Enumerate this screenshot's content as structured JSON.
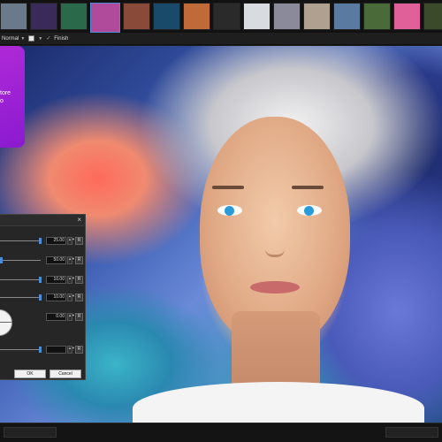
{
  "thumbnails": [
    {
      "name": "thumb-1",
      "color": "#6a7a8a"
    },
    {
      "name": "thumb-2",
      "color": "#3a2a5a"
    },
    {
      "name": "thumb-3",
      "color": "#2a6a4a"
    },
    {
      "name": "thumb-4",
      "color": "#b04a9a",
      "active": true
    },
    {
      "name": "thumb-5",
      "color": "#8a4a3a"
    },
    {
      "name": "thumb-6",
      "color": "#1a4a6a"
    },
    {
      "name": "thumb-7",
      "color": "#c06a3a"
    },
    {
      "name": "thumb-8",
      "color": "#2a2a2a"
    },
    {
      "name": "thumb-9",
      "color": "#d8dce0"
    },
    {
      "name": "thumb-10",
      "color": "#8a8a9a"
    },
    {
      "name": "thumb-11",
      "color": "#b0a090"
    },
    {
      "name": "thumb-12",
      "color": "#5a7aa0"
    },
    {
      "name": "thumb-13",
      "color": "#4a6a3a"
    },
    {
      "name": "thumb-14",
      "color": "#e0609a"
    },
    {
      "name": "thumb-15",
      "color": "#3a4a2a"
    }
  ],
  "options_bar": {
    "blend_mode": "Normal",
    "finish_label": "Finish"
  },
  "promo": {
    "line1": "tore",
    "line2": "o"
  },
  "dialog": {
    "close_icon": "×",
    "rows": [
      {
        "value": "25.00",
        "level": 1.0
      },
      {
        "value": "50.00",
        "level": 0.0
      },
      {
        "value": "10.00",
        "level": 1.0
      },
      {
        "value": "10.00",
        "level": 1.0
      },
      {
        "value": "0.00",
        "level": null
      },
      {
        "value": "",
        "level": 1.0
      }
    ],
    "reset_label": "R",
    "ok_label": "OK",
    "cancel_label": "Cancel"
  },
  "colors": {
    "accent": "#4a8cd8",
    "promo": "#a020d0"
  }
}
